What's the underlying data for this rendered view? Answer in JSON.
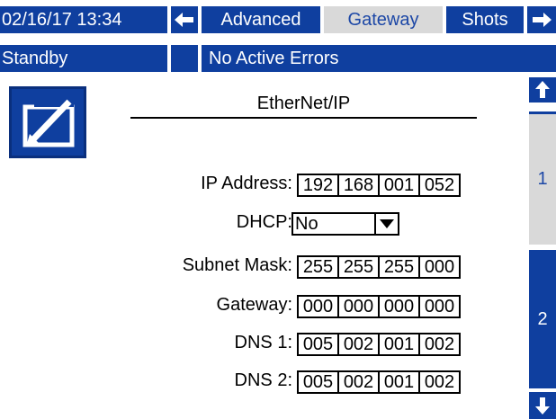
{
  "header": {
    "datetime": "02/16/17 13:34",
    "tabs": [
      {
        "label": "Advanced",
        "active": false
      },
      {
        "label": "Gateway",
        "active": true
      },
      {
        "label": "Shots",
        "active": false
      }
    ],
    "prev_icon": "arrow-left-icon",
    "next_icon": "arrow-right-icon"
  },
  "status": {
    "mode": "Standby",
    "indicator": "",
    "errors": "No Active Errors"
  },
  "edit_icon": "edit-icon",
  "section_title": "EtherNet/IP",
  "fields": {
    "ip_address": {
      "label": "IP Address:",
      "octets": [
        "192",
        "168",
        "001",
        "052"
      ]
    },
    "dhcp": {
      "label": "DHCP:",
      "value": "No"
    },
    "subnet_mask": {
      "label": "Subnet Mask:",
      "octets": [
        "255",
        "255",
        "255",
        "000"
      ]
    },
    "gateway": {
      "label": "Gateway:",
      "octets": [
        "000",
        "000",
        "000",
        "000"
      ]
    },
    "dns1": {
      "label": "DNS 1:",
      "octets": [
        "005",
        "002",
        "001",
        "002"
      ]
    },
    "dns2": {
      "label": "DNS 2:",
      "octets": [
        "005",
        "002",
        "001",
        "002"
      ]
    }
  },
  "pager": {
    "up_icon": "arrow-up-icon",
    "down_icon": "arrow-down-icon",
    "pages": [
      {
        "label": "1",
        "active": true
      },
      {
        "label": "2",
        "active": false
      }
    ]
  },
  "colors": {
    "primary_blue": "#0f3f9f",
    "active_tab": "#d9d9d9",
    "background": "#ffffff"
  }
}
